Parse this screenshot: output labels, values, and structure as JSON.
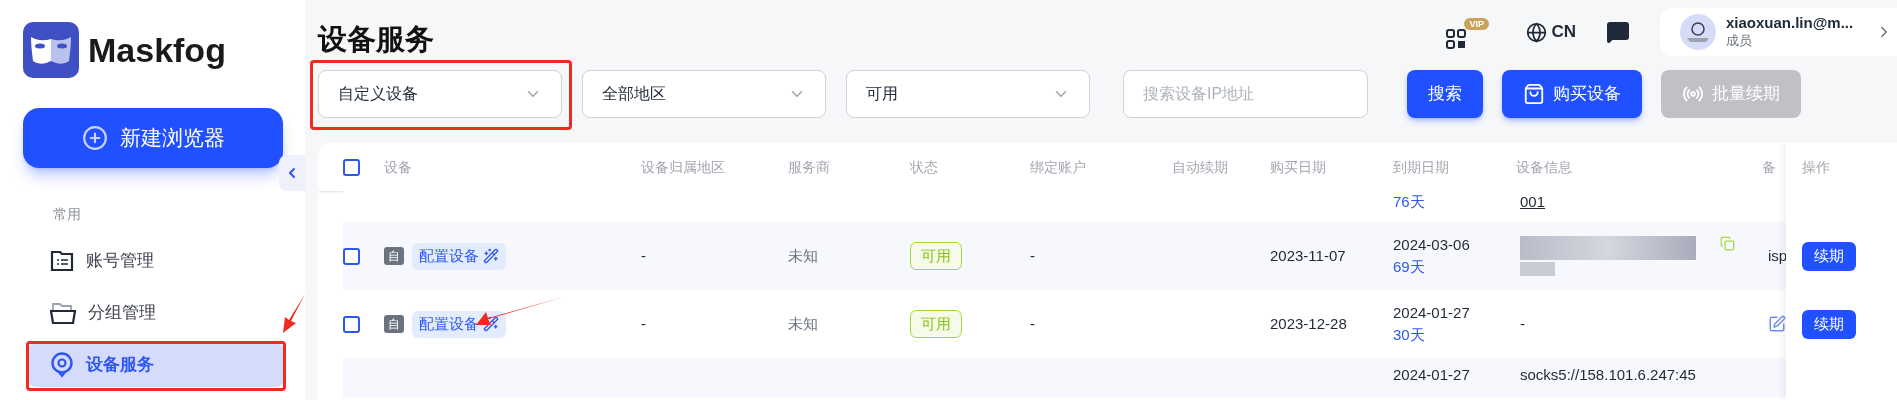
{
  "sidebar": {
    "logo": "Maskfog",
    "new_button": "新建浏览器",
    "section": "常用",
    "items": [
      {
        "label": "账号管理",
        "kind": "list",
        "selected": false,
        "annotated": false
      },
      {
        "label": "分组管理",
        "kind": "folder",
        "selected": false,
        "annotated": false
      },
      {
        "label": "设备服务",
        "kind": "pin",
        "selected": true,
        "annotated": true
      }
    ]
  },
  "header": {
    "title": "设备服务",
    "vip_badge": "VIP",
    "language": "CN",
    "user": {
      "email": "xiaoxuan.lin@m...",
      "role": "成员"
    }
  },
  "filters": {
    "selects": [
      {
        "value": "自定义设备",
        "annotated": true
      },
      {
        "value": "全部地区",
        "annotated": false
      },
      {
        "value": "可用",
        "annotated": false
      }
    ],
    "search": {
      "placeholder": "搜索设备IP地址"
    },
    "buttons": [
      {
        "label": "搜索",
        "kind": "plain",
        "disabled": false
      },
      {
        "label": "购买设备",
        "kind": "bag",
        "disabled": false
      },
      {
        "label": "批量续期",
        "kind": "signal",
        "disabled": true
      }
    ]
  },
  "table": {
    "all_checked": false,
    "columns": [
      "设备",
      "设备归属地区",
      "服务商",
      "状态",
      "绑定账户",
      "自动续期",
      "购买日期",
      "到期日期",
      "设备信息",
      "备",
      "操作"
    ],
    "rows": [
      {
        "kind": "partial",
        "days": "76天",
        "info": "001"
      },
      {
        "kind": "full",
        "checked": false,
        "type_tag": "自",
        "config": "配置设备",
        "annotated": false,
        "region": "-",
        "provider": "未知",
        "status": "可用",
        "account": "-",
        "purchase": "2023-11-07",
        "expiry": "2024-03-06",
        "days": "69天",
        "info_redacted": true,
        "remark": "isp",
        "remark_edit": false,
        "action": "续期"
      },
      {
        "kind": "full",
        "checked": false,
        "type_tag": "自",
        "config": "配置设备",
        "annotated": true,
        "region": "-",
        "provider": "未知",
        "status": "可用",
        "account": "-",
        "purchase": "2023-12-28",
        "expiry": "2024-01-27",
        "days": "30天",
        "info_redacted": false,
        "info": "-",
        "remark_edit": true,
        "action": "续期"
      },
      {
        "kind": "cut",
        "expiry": "2024-01-27",
        "info": "socks5://158.101.6.247:45"
      }
    ]
  }
}
